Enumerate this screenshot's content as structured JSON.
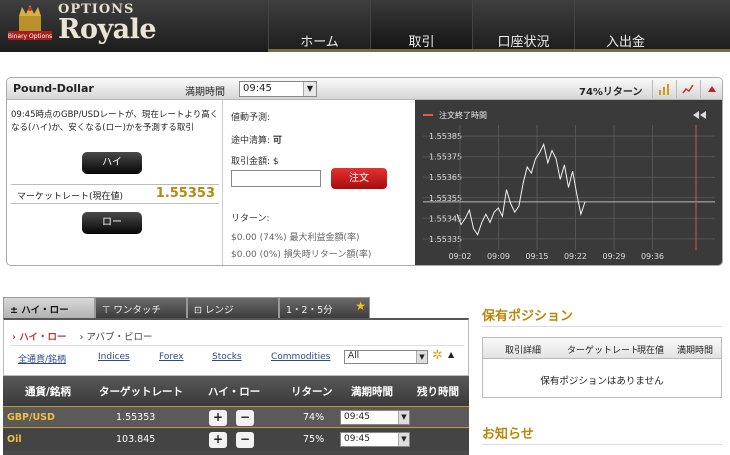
{
  "header": {
    "brand_top": "OPTIONS",
    "brand_main": "Royale",
    "logo_ribbon": "Binary Options",
    "nav": [
      {
        "label": "ホーム",
        "active": false
      },
      {
        "label": "取引",
        "active": true
      },
      {
        "label": "口座状況",
        "active": false
      },
      {
        "label": "入出金",
        "active": false
      }
    ]
  },
  "trade": {
    "pair": "Pound-Dollar",
    "expiry_label": "満期時間",
    "expiry_value": "09:45",
    "return_rate": "74%リターン",
    "description": "09:45時点のGBP/USDレートが、現在レートより高くなる(ハイ)か、安くなる(ロー)かを予測する取引",
    "high_button": "ハイ",
    "low_button": "ロー",
    "market_label": "マーケットレート(現在値)",
    "market_value": "1.55353",
    "price_forecast": "値動予測:",
    "early_close_label": "途中清算:",
    "early_close_value": "可",
    "amount_label": "取引金額:",
    "amount_currency": "$",
    "amount_value": "",
    "order_button": "注文",
    "return_label": "リターン:",
    "max_profit": "$0.00 (74%) 最大利益金額(率)",
    "loss_return": "$0.00 (0%) 損失時リターン額(率)"
  },
  "chart_data": {
    "type": "line",
    "legend": "注文終了時間",
    "y_ticks": [
      "1.55385",
      "1.55375",
      "1.55365",
      "1.55355",
      "1.55345",
      "1.55335"
    ],
    "x_ticks": [
      "09:02",
      "09:09",
      "09:15",
      "09:22",
      "09:29",
      "09:36"
    ],
    "ylim": [
      1.55332,
      1.55388
    ],
    "current_rate": 1.55353,
    "expiry_marker": "09:45",
    "series": [
      {
        "values": [
          1.55347,
          1.55342,
          1.55345,
          1.55349,
          1.5534,
          1.55337,
          1.55343,
          1.55347,
          1.55343,
          1.55348,
          1.5535,
          1.55346,
          1.55359,
          1.55352,
          1.55348,
          1.55351,
          1.55362,
          1.5537,
          1.55367,
          1.55374,
          1.55377,
          1.55381,
          1.55372,
          1.55378,
          1.55374,
          1.55364,
          1.55371,
          1.5536,
          1.55368,
          1.55357,
          1.55347,
          1.55353
        ]
      }
    ],
    "grid": true
  },
  "tabs": [
    {
      "label": "ハイ・ロー",
      "icon": "plus-minus-icon",
      "active": true
    },
    {
      "label": "ワンタッチ",
      "icon": "touch-icon",
      "active": false
    },
    {
      "label": "レンジ",
      "icon": "range-icon",
      "active": false
    },
    {
      "label": "1・2・5分",
      "icon": "",
      "active": false
    }
  ],
  "subtabs": {
    "active": "ハイ・ロー",
    "other": "アバブ・ビロー"
  },
  "filters": {
    "links": [
      "全通貨/銘柄",
      "Indices",
      "Forex",
      "Stocks",
      "Commodities"
    ],
    "select_value": "All"
  },
  "table": {
    "headers": [
      "通貨/銘柄",
      "ターゲットレート",
      "ハイ・ロー",
      "リターン",
      "満期時間",
      "残り時間"
    ],
    "rows": [
      {
        "asset": "GBP/USD",
        "rate": "1.55353",
        "ret": "74%",
        "expiry": "09:45",
        "remaining": ""
      },
      {
        "asset": "Oil",
        "rate": "103.845",
        "ret": "75%",
        "expiry": "09:45",
        "remaining": ""
      }
    ]
  },
  "positions": {
    "title": "保有ポジション",
    "headers": [
      "取引詳細",
      "ターゲットレート",
      "現在値",
      "満期時間"
    ],
    "empty": "保有ポジションはありません"
  },
  "news": {
    "title": "お知らせ"
  },
  "colors": {
    "accent_gold": "#b58a11",
    "order_red": "#c81e1e",
    "chart_bg": "#3a3a3a"
  }
}
